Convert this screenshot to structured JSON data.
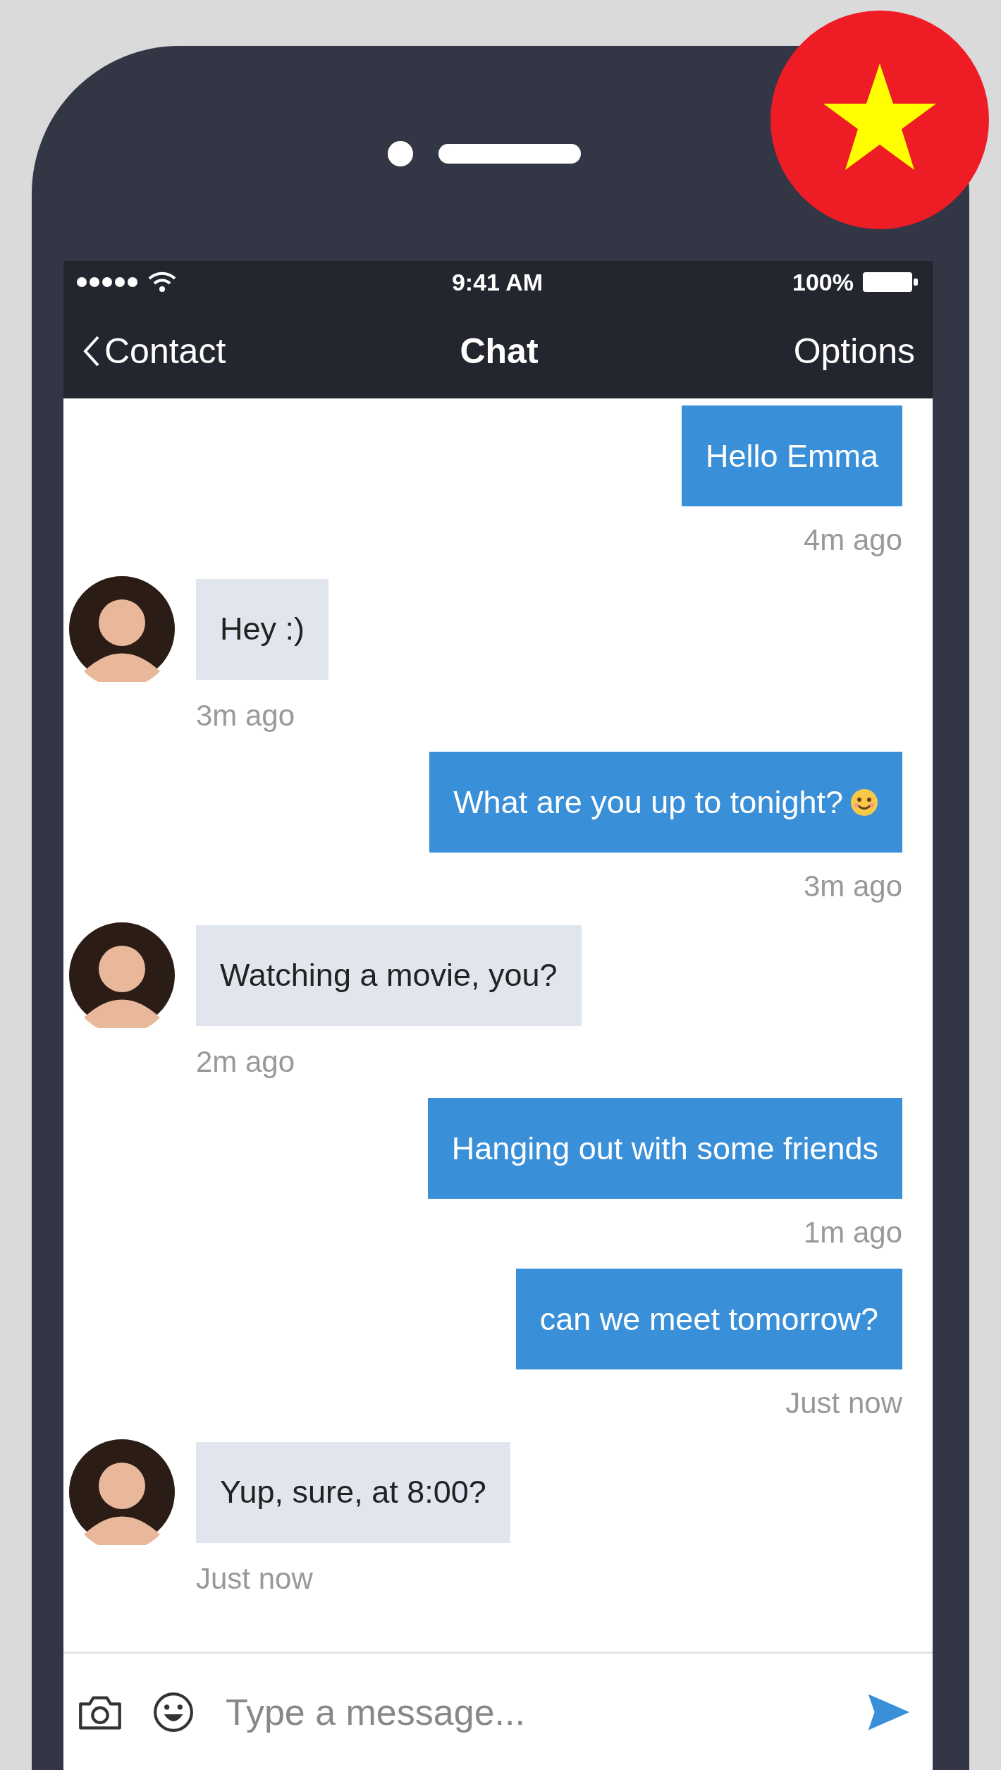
{
  "status_bar": {
    "time": "9:41 AM",
    "battery": "100%"
  },
  "nav": {
    "back": "Contact",
    "title": "Chat",
    "action": "Options"
  },
  "messages": [
    {
      "kind": "sent",
      "text": "Hello Emma",
      "time": "4m ago"
    },
    {
      "kind": "received",
      "text": "Hey :)",
      "time": "3m ago"
    },
    {
      "kind": "sent",
      "text": "What are you up to tonight?",
      "emoji": true,
      "time": "3m ago"
    },
    {
      "kind": "received",
      "text": "Watching a movie, you?",
      "time": "2m ago"
    },
    {
      "kind": "sent",
      "text": "Hanging out with some friends",
      "time": "1m ago"
    },
    {
      "kind": "sent",
      "text": "can we meet tomorrow?",
      "time": "Just now"
    },
    {
      "kind": "received",
      "text": "Yup, sure, at 8:00?",
      "time": "Just now"
    }
  ],
  "composer": {
    "placeholder": "Type a message..."
  }
}
